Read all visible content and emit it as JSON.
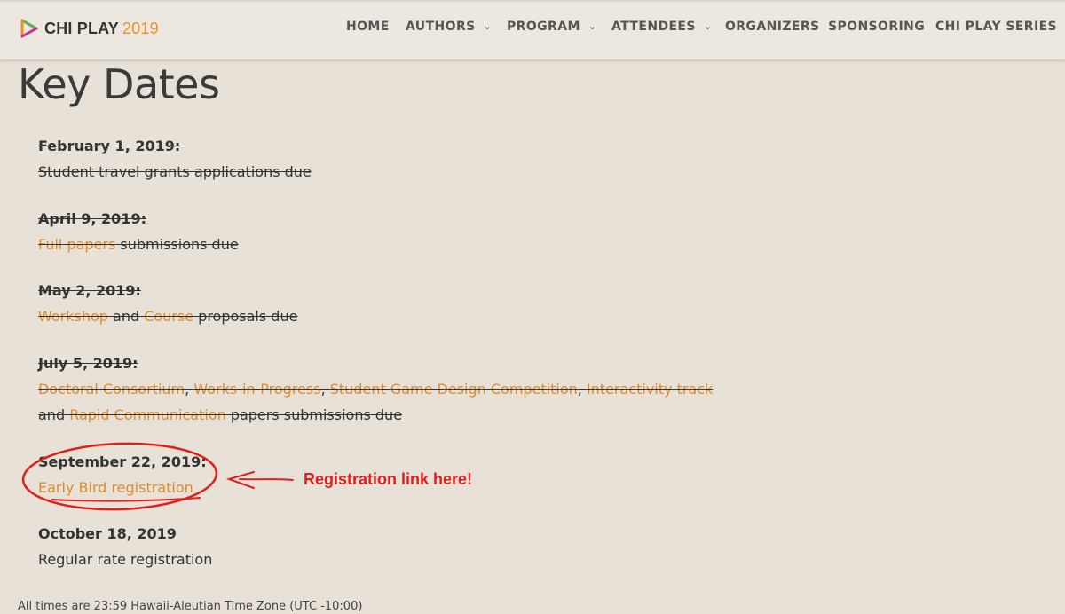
{
  "header": {
    "logo_name": "CHI PLAY",
    "logo_year": "2019",
    "nav": [
      {
        "label": "HOME",
        "dropdown": false
      },
      {
        "label": "AUTHORS",
        "dropdown": true
      },
      {
        "label": "PROGRAM",
        "dropdown": true
      },
      {
        "label": "ATTENDEES",
        "dropdown": true
      },
      {
        "label": "ORGANIZERS",
        "dropdown": false
      },
      {
        "label": "SPONSORING",
        "dropdown": false
      },
      {
        "label": "CHI PLAY SERIES",
        "dropdown": true
      }
    ]
  },
  "page": {
    "title": "Key Dates",
    "entries": [
      {
        "date": "February 1, 2019:",
        "text1": "Student travel grants applications due",
        "past": true
      },
      {
        "date": "April 9, 2019:",
        "link1": "Full papers",
        "text1": " submissions due",
        "past": true
      },
      {
        "date": "May 2, 2019:",
        "link1": "Workshop",
        "text1": " and ",
        "link2": "Course",
        "text2": " proposals due",
        "past": true
      },
      {
        "date": "July 5, 2019:",
        "links": [
          "Doctoral Consortium",
          "Works-in-Progress",
          "Student Game Design Competition",
          "Interactivity track"
        ],
        "separator": ", ",
        "line2_prefix": "and ",
        "line2_link": "Rapid Communication",
        "line2_text": " papers submissions due",
        "past": true
      },
      {
        "date": "September 22, 2019:",
        "link1": "Early Bird registration",
        "past": false
      },
      {
        "date": "October 18, 2019",
        "text1": "Regular rate registration",
        "past": false
      }
    ],
    "footer_note": "All times are 23:59 Hawaii-Aleutian Time Zone (UTC -10:00)"
  },
  "annotation": {
    "text": "Registration link here!",
    "color": "#e0201b"
  },
  "colors": {
    "background": "#e7e1d7",
    "header": "#ede8df",
    "link": "#e08a2e",
    "text": "#333333"
  }
}
